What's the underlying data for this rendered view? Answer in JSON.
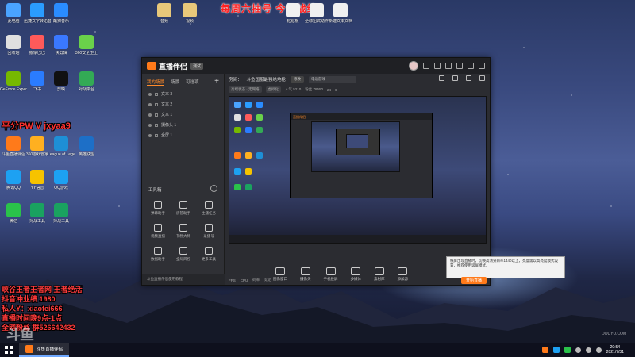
{
  "banner": {
    "text": "每周六抽号 今日战绩"
  },
  "desktop": {
    "icons": [
      {
        "label": "此电脑",
        "color": "#4aa3ff"
      },
      {
        "label": "迅捷文字转语音",
        "color": "#2a9cff"
      },
      {
        "label": "酷狗音乐",
        "color": "#2a8cff"
      },
      {
        "label": "回收站",
        "color": "#e0e0e0"
      },
      {
        "label": "搬家巴巴",
        "color": "#ff5a5a"
      },
      {
        "label": "快剪辑",
        "color": "#3a78ff"
      },
      {
        "label": "360安全卫士",
        "color": "#6ad14a"
      },
      {
        "label": "GeForce Experience",
        "color": "#76b900"
      },
      {
        "label": "飞书",
        "color": "#2a7cff"
      },
      {
        "label": "剪映",
        "color": "#111111"
      },
      {
        "label": "对战平台",
        "color": "#33aa55"
      },
      {
        "label": "斗鱼直播伴侣",
        "color": "#ff7a1a"
      },
      {
        "label": "360游戏管家",
        "color": "#ffb020"
      },
      {
        "label": "League of Legends",
        "color": "#1e8fd6"
      },
      {
        "label": "英雄联盟",
        "color": "#1d6fc7"
      },
      {
        "label": "腾讯QQ",
        "color": "#1da1f2"
      },
      {
        "label": "YY语音",
        "color": "#f6c300"
      },
      {
        "label": "QQ游戏",
        "color": "#1da1f2"
      },
      {
        "label": "微信",
        "color": "#2ac24a"
      },
      {
        "label": "对战工具",
        "color": "#1aa260"
      },
      {
        "label": "对战工具",
        "color": "#1aa260"
      }
    ],
    "top_files": [
      {
        "label": "音频"
      },
      {
        "label": "视频"
      },
      {
        "label": "粘贴板"
      },
      {
        "label": "全球招式动作"
      },
      {
        "label": "新建文本文档"
      }
    ]
  },
  "overlay": {
    "promo": "平分PW V jxyaa9",
    "lines": [
      "峡谷王者王者网 王者绝活",
      "抖音冲业绩 1980",
      "私人Y：xiaofei666",
      "直播时间晚9点-1点",
      "全网粉丝 群526642432"
    ]
  },
  "app": {
    "name": "直播伴侣",
    "version": "测试",
    "tabs": [
      "我的场景",
      "场景",
      "可选项"
    ],
    "layers": [
      "文本 3",
      "文本 2",
      "文本 1",
      "摄像头 1",
      "全屏 1"
    ],
    "toolbox": "工具箱",
    "tools": [
      "弹幕助手",
      "房管助手",
      "主播任务",
      "视频直播",
      "礼物大师",
      "录播号",
      "数据助手",
      "全局风控",
      "更多工具"
    ],
    "footer": "斗鱼直播伴侣使用教程",
    "room": {
      "label": "房间：",
      "title": "斗鱼国服最强绝地枪",
      "edit": "修改",
      "category": "电话游戏"
    },
    "stats": [
      "高端状态 · 无网络",
      "虚拟化",
      "人气 5210",
      "粉丝 78550",
      "24",
      "6"
    ],
    "sources": [
      "图像窗口",
      "摄像头",
      "手机投屏",
      "多媒体",
      "素材库",
      "添加源"
    ],
    "tip": "横屏出现直播时，切换高清分辨率1440以上，亮度需以高亮度模式设置，推荐使用竖屏模式。",
    "status": [
      "FPS",
      "CPU",
      "码率",
      "延迟"
    ],
    "live_button": "开始直播"
  },
  "watermark": {
    "brand": "斗鱼",
    "url": "DOUYU.COM"
  },
  "taskbar": {
    "app_label": "斗鱼直播伴侣",
    "time": "20:54",
    "date": "2021/7/31"
  }
}
